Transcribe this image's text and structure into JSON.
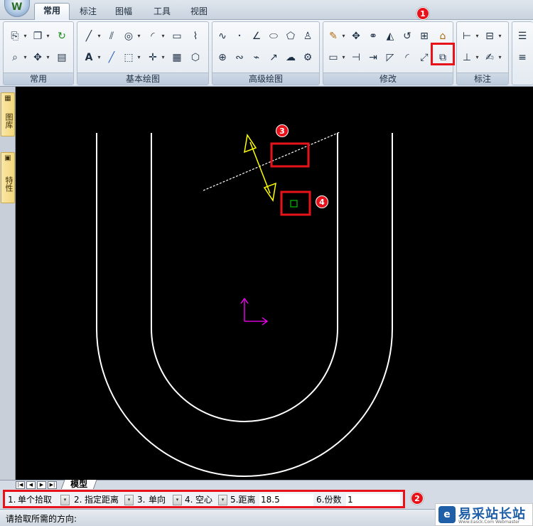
{
  "tabs": [
    "常用",
    "标注",
    "图幅",
    "工具",
    "视图"
  ],
  "ribbon_groups": [
    "常用",
    "基本绘图",
    "高级绘图",
    "修改",
    "标注"
  ],
  "sidebar_tabs": [
    "图库",
    "特性"
  ],
  "annotations": [
    "1",
    "2",
    "3",
    "4"
  ],
  "model_tab": "模型",
  "propbar": {
    "item1_label": "1.",
    "item1_value": "单个拾取",
    "item2_label": "2.",
    "item2_value": "指定距离",
    "item3_label": "3.",
    "item3_value": "单向",
    "item4_label": "4.",
    "item4_value": "空心",
    "item5_label": "5.距离",
    "item5_value": "18.5",
    "item6_label": "6.份数",
    "item6_value": "1"
  },
  "status_text": "请拾取所需的方向:",
  "watermark": {
    "title": "易采站长站",
    "sub": "Www.Easck.Com Webmaster"
  },
  "colors": {
    "highlight": "#e8121b",
    "canvas": "#000000",
    "arrow": "#ffff00",
    "ucs": "#ff00ff",
    "cursor": "#00c000"
  }
}
